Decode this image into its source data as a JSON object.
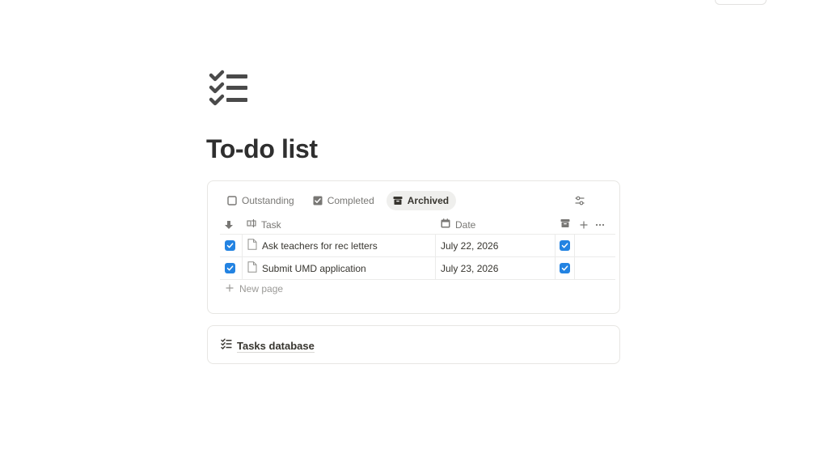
{
  "page": {
    "title": "To-do list",
    "icon": "checklist-icon"
  },
  "view_tabs": [
    {
      "label": "Outstanding",
      "icon": "empty-checkbox-icon",
      "active": false
    },
    {
      "label": "Completed",
      "icon": "checked-box-icon",
      "active": false
    },
    {
      "label": "Archived",
      "icon": "archive-box-icon",
      "active": true
    }
  ],
  "table": {
    "columns": {
      "task": "Task",
      "date": "Date"
    },
    "rows": [
      {
        "done": true,
        "task": "Ask teachers for rec letters",
        "date": "July 22, 2026",
        "archived": true
      },
      {
        "done": true,
        "task": "Submit UMD application",
        "date": "July 23, 2026",
        "archived": true
      }
    ],
    "new_page_label": "New page"
  },
  "linked_database": {
    "label": "Tasks database",
    "icon": "checklist-icon"
  },
  "colors": {
    "accent": "#2383e2",
    "text": "#37352f",
    "muted": "#787774",
    "border": "#e7e6e3"
  }
}
